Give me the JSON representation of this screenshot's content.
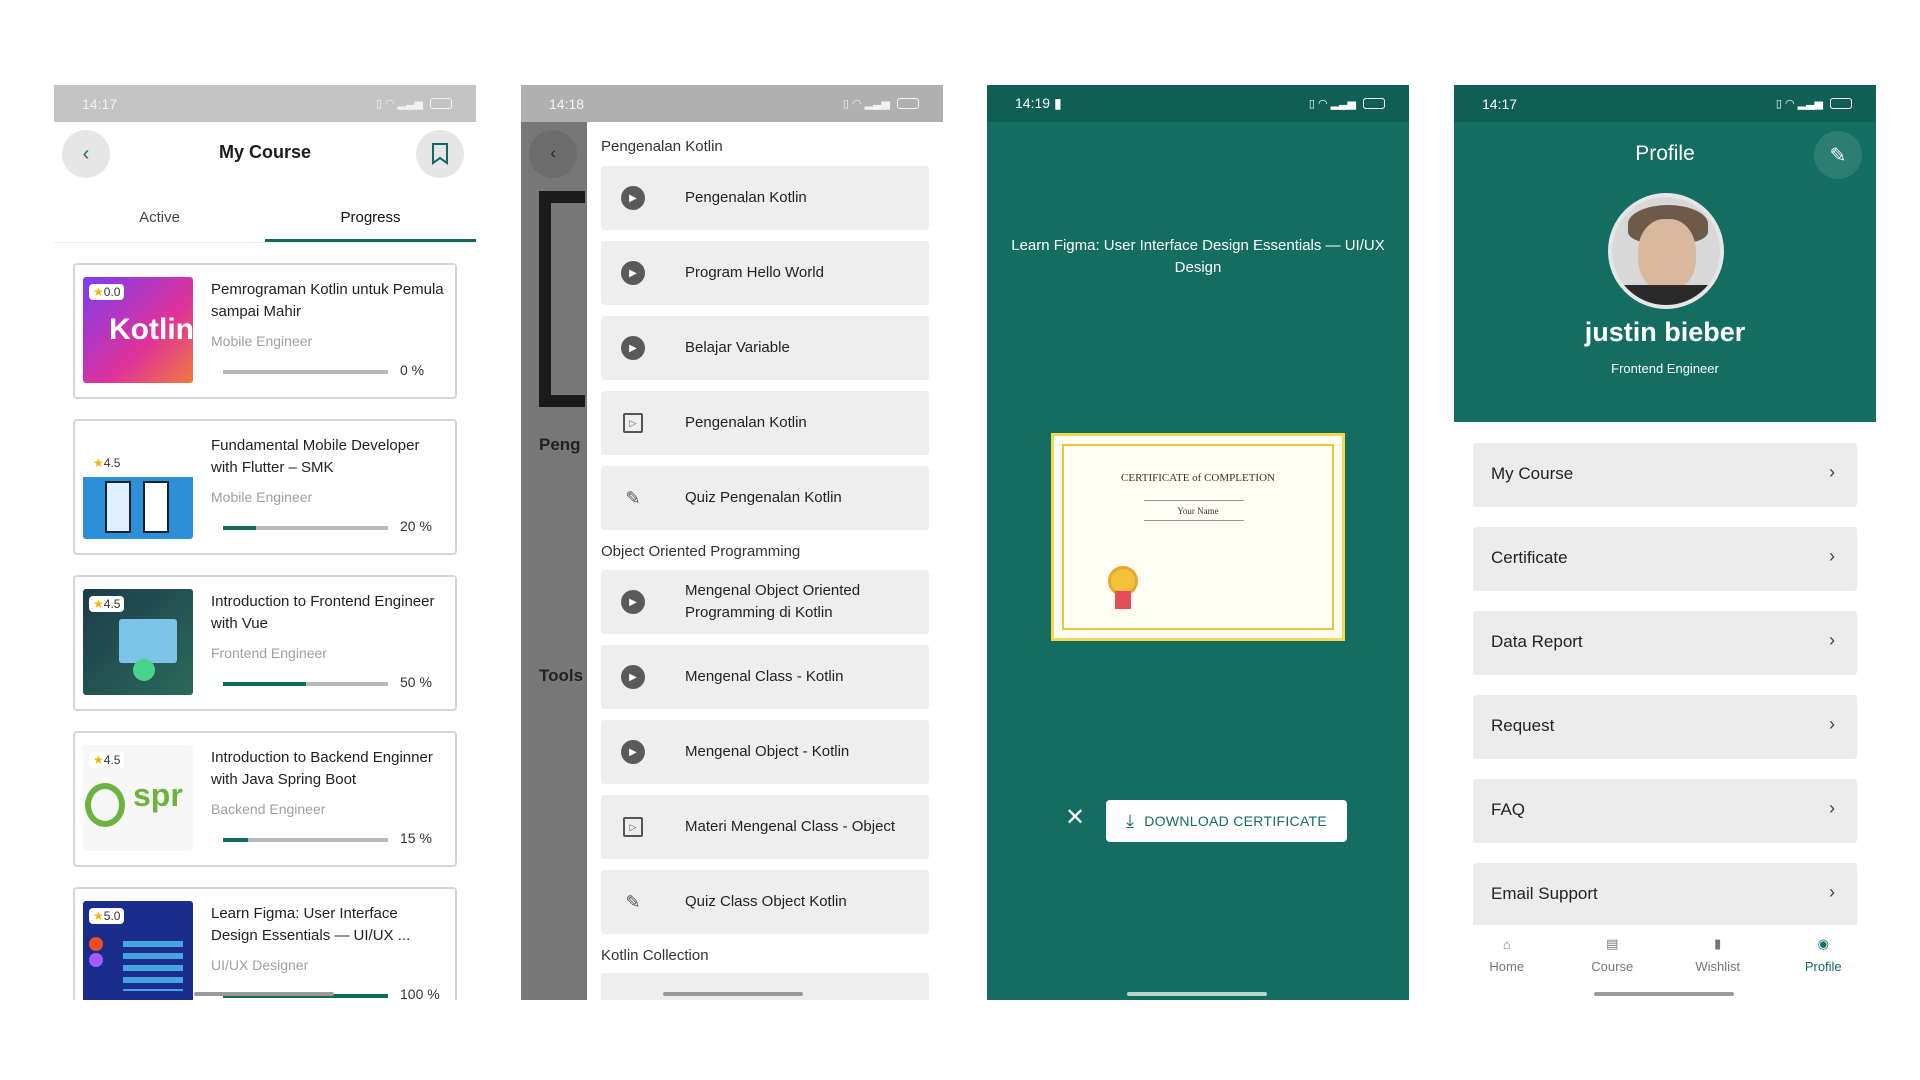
{
  "colors": {
    "primary": "#136d61",
    "accent": "#116b5d",
    "rating_star": "#f2b600"
  },
  "panel1": {
    "status_time": "14:17",
    "title": "My Course",
    "tabs": [
      "Active",
      "Progress"
    ],
    "active_tab": "Progress",
    "courses": [
      {
        "rating": "0.0",
        "title": "Pemrograman Kotlin untuk Pemula sampai Mahir",
        "category": "Mobile Engineer",
        "progress_text": "0 %",
        "progress": 0
      },
      {
        "rating": "4.5",
        "title": "Fundamental Mobile Developer with Flutter – SMK",
        "category": "Mobile Engineer",
        "progress_text": "20 %",
        "progress": 20
      },
      {
        "rating": "4.5",
        "title": "Introduction to Frontend Engineer with Vue",
        "category": "Frontend Engineer",
        "progress_text": "50 %",
        "progress": 50
      },
      {
        "rating": "4.5",
        "title": "Introduction to Backend Enginner with Java Spring Boot",
        "category": "Backend Engineer",
        "progress_text": "15 %",
        "progress": 15
      },
      {
        "rating": "5.0",
        "title": "Learn Figma: User Interface Design Essentials — UI/UX ...",
        "category": "UI/UX Designer",
        "progress_text": "100 %",
        "progress": 100
      }
    ]
  },
  "panel2": {
    "status_time": "14:18",
    "behind_texts": [
      "Peng",
      "Tools"
    ],
    "sections": [
      {
        "title": "Pengenalan Kotlin"
      },
      {
        "title": "Object Oriented Programming"
      },
      {
        "title": "Kotlin Collection"
      }
    ],
    "lessons": [
      {
        "icon": "play-icon",
        "label": "Pengenalan Kotlin"
      },
      {
        "icon": "play-icon",
        "label": "Program Hello World"
      },
      {
        "icon": "play-icon",
        "label": "Belajar Variable"
      },
      {
        "icon": "reading-icon",
        "label": "Pengenalan Kotlin"
      },
      {
        "icon": "quiz-icon",
        "label": "Quiz Pengenalan Kotlin"
      },
      {
        "icon": "play-icon",
        "label": "Mengenal Object Oriented Programming di Kotlin"
      },
      {
        "icon": "play-icon",
        "label": "Mengenal Class - Kotlin"
      },
      {
        "icon": "play-icon",
        "label": "Mengenal Object - Kotlin"
      },
      {
        "icon": "reading-icon",
        "label": "Materi Mengenal Class - Object"
      },
      {
        "icon": "quiz-icon",
        "label": "Quiz Class Object Kotlin"
      }
    ]
  },
  "panel3": {
    "status_time": "14:19",
    "course_title": "Learn Figma: User Interface Design Essentials — UI/UX Design",
    "certificate_heading": "CERTIFICATE of COMPLETION",
    "certificate_name": "Your Name",
    "download_label": "DOWNLOAD CERTIFICATE"
  },
  "panel4": {
    "status_time": "14:17",
    "title": "Profile",
    "name": "justin bieber",
    "role": "Frontend Engineer",
    "menu": [
      "My Course",
      "Certificate",
      "Data Report",
      "Request",
      "FAQ",
      "Email Support"
    ],
    "nav": [
      {
        "icon": "home-icon",
        "label": "Home"
      },
      {
        "icon": "course-icon",
        "label": "Course"
      },
      {
        "icon": "wishlist-icon",
        "label": "Wishlist"
      },
      {
        "icon": "profile-icon",
        "label": "Profile"
      }
    ],
    "active_nav": "Profile"
  }
}
